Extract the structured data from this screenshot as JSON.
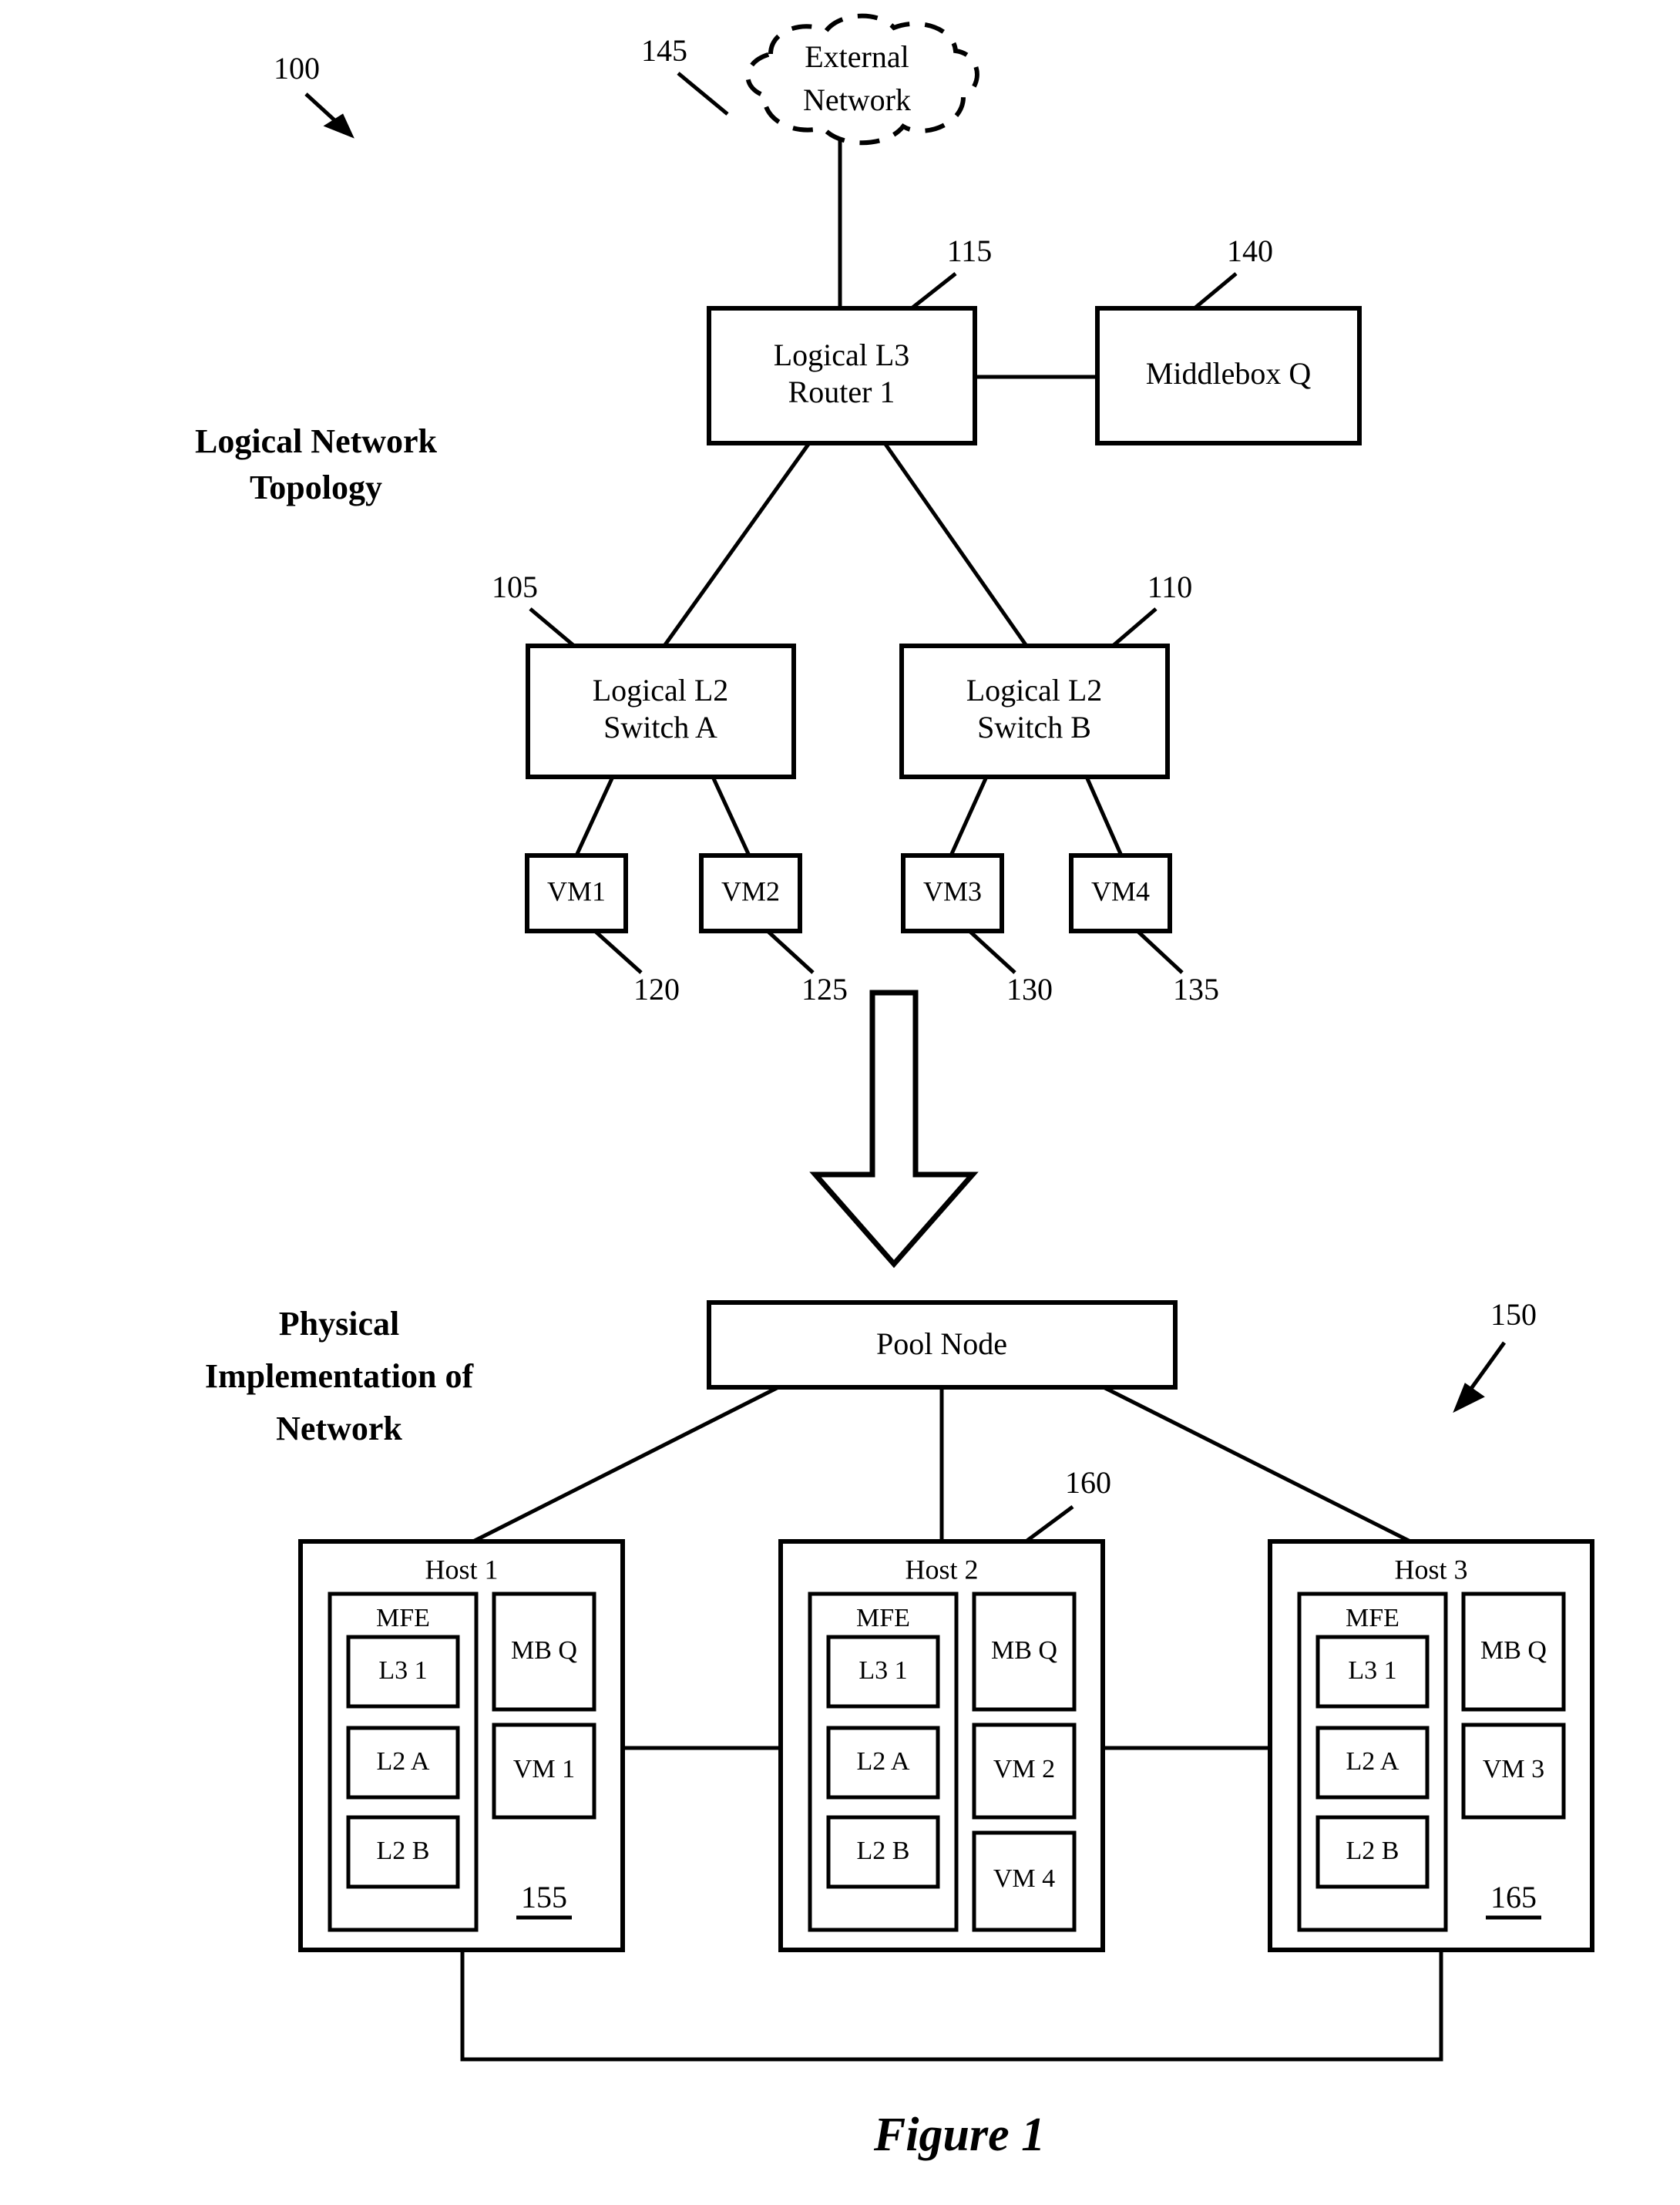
{
  "figure": {
    "caption": "Figure 1",
    "top_ref": "100"
  },
  "sections": {
    "logical": {
      "label_line1": "Logical Network",
      "label_line2": "Topology"
    },
    "physical": {
      "label_line1": "Physical",
      "label_line2": "Implementation of",
      "label_line3": "Network",
      "ref": "150"
    }
  },
  "logical_topology": {
    "external_network": {
      "label_line1": "External",
      "label_line2": "Network",
      "ref": "145"
    },
    "router": {
      "label_line1": "Logical L3",
      "label_line2": "Router 1",
      "ref": "115"
    },
    "middlebox": {
      "label": "Middlebox Q",
      "ref": "140"
    },
    "switches": [
      {
        "label_line1": "Logical L2",
        "label_line2": "Switch A",
        "ref": "105"
      },
      {
        "label_line1": "Logical L2",
        "label_line2": "Switch B",
        "ref": "110"
      }
    ],
    "vms": [
      {
        "label": "VM1",
        "ref": "120"
      },
      {
        "label": "VM2",
        "ref": "125"
      },
      {
        "label": "VM3",
        "ref": "130"
      },
      {
        "label": "VM4",
        "ref": "135"
      }
    ]
  },
  "physical_implementation": {
    "pool_node": {
      "label": "Pool Node"
    },
    "hosts": [
      {
        "title": "Host 1",
        "ref": "155",
        "ref_underlined": true,
        "mfe": {
          "label": "MFE",
          "elements": [
            "L3 1",
            "L2 A",
            "L2 B"
          ]
        },
        "right_column": [
          "MB Q",
          "VM 1"
        ]
      },
      {
        "title": "Host 2",
        "ref": "160",
        "ref_underlined": false,
        "mfe": {
          "label": "MFE",
          "elements": [
            "L3 1",
            "L2 A",
            "L2 B"
          ]
        },
        "right_column": [
          "MB Q",
          "VM 2",
          "VM 4"
        ]
      },
      {
        "title": "Host 3",
        "ref": "165",
        "ref_underlined": true,
        "mfe": {
          "label": "MFE",
          "elements": [
            "L3 1",
            "L2 A",
            "L2 B"
          ]
        },
        "right_column": [
          "MB Q",
          "VM 3"
        ]
      }
    ]
  },
  "colors": {
    "stroke": "#000000",
    "fill": "#ffffff"
  }
}
